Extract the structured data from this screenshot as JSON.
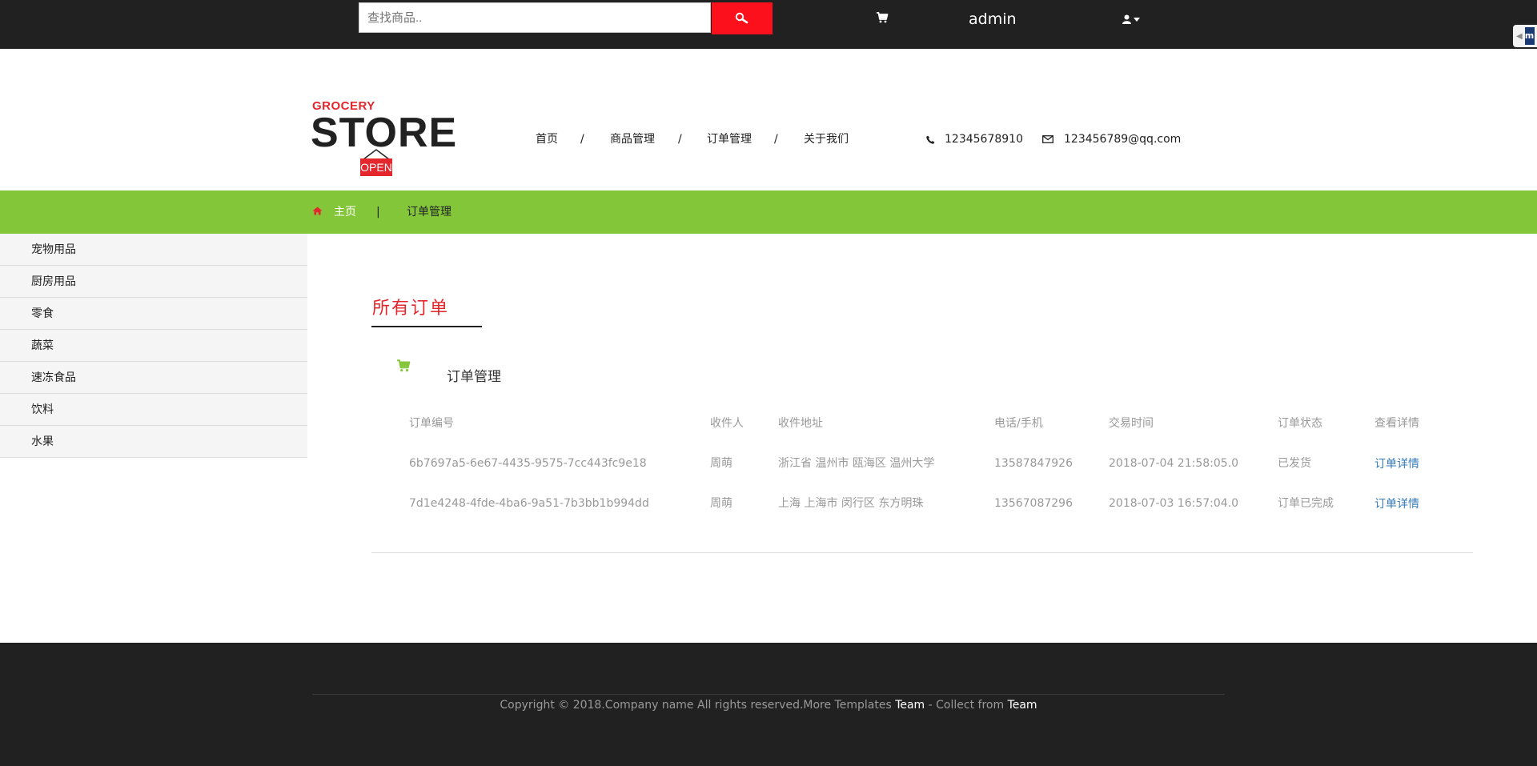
{
  "topbar": {
    "search_placeholder": "查找商品..",
    "username": "admin",
    "side_badge": "m"
  },
  "logo": {
    "small": "GROCERY",
    "big": "STORE",
    "sign": "OPEN"
  },
  "nav": {
    "items": [
      "首页",
      "商品管理",
      "订单管理",
      "关于我们"
    ],
    "separator": "/"
  },
  "contact": {
    "phone": "12345678910",
    "email": "123456789@qq.com"
  },
  "breadcrumb": {
    "home": "主页",
    "separator": "|",
    "current": "订单管理"
  },
  "sidebar": {
    "items": [
      "宠物用品",
      "厨房用品",
      "零食",
      "蔬菜",
      "速冻食品",
      "饮料",
      "水果"
    ]
  },
  "main": {
    "title": "所有订单",
    "panel_title": "订单管理",
    "table": {
      "headers": [
        "订单编号",
        "收件人",
        "收件地址",
        "电话/手机",
        "交易时间",
        "订单状态",
        "查看详情"
      ],
      "rows": [
        [
          "6b7697a5-6e67-4435-9575-7cc443fc9e18",
          "周萌",
          "浙江省 温州市 瓯海区 温州大学",
          "13587847926",
          "2018-07-04 21:58:05.0",
          "已发货",
          "订单详情"
        ],
        [
          "7d1e4248-4fde-4ba6-9a51-7b3bb1b994dd",
          "周萌",
          "上海 上海市 闵行区 东方明珠",
          "13567087296",
          "2018-07-03 16:57:04.0",
          "订单已完成",
          "订单详情"
        ]
      ]
    }
  },
  "footer": {
    "copyright": "Copyright © 2018.Company name All rights reserved.More Templates ",
    "team1": "Team",
    "middle": " - Collect from ",
    "team2": "Team"
  },
  "colors": {
    "topbar_bg": "#212121",
    "search_button": "#fb101c",
    "accent_green": "#84c639",
    "title_red": "#e3272d",
    "link_blue": "#337ab7"
  },
  "icons": [
    "search-icon",
    "cart-icon",
    "user-icon",
    "phone-icon",
    "envelope-icon",
    "home-icon"
  ]
}
